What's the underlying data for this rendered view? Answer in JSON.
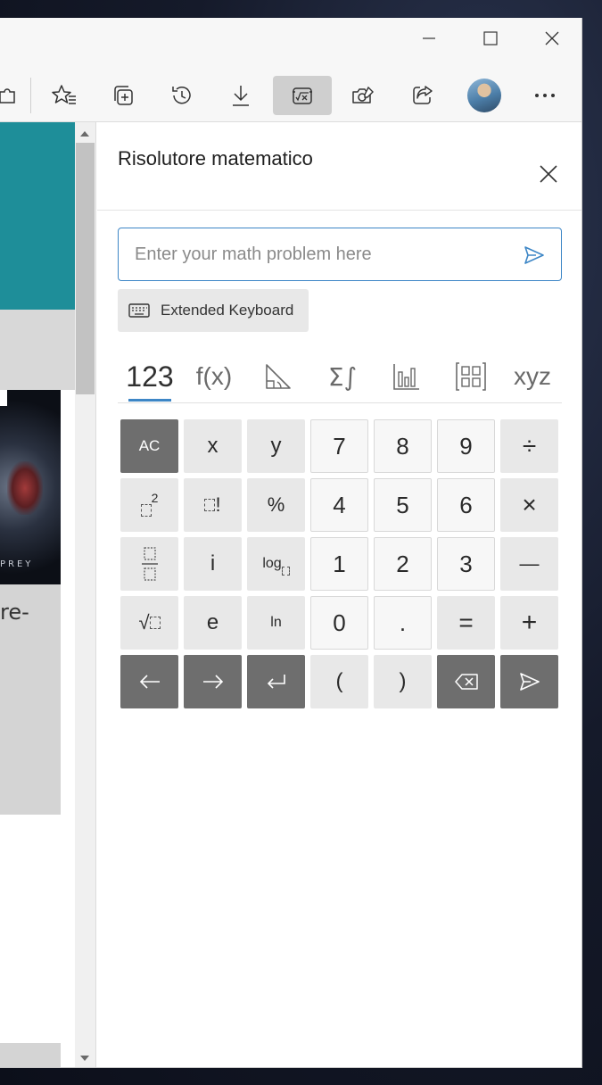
{
  "panel": {
    "title": "Risolutore matematico",
    "input_placeholder": "Enter your math problem here",
    "extended_keyboard_label": "Extended Keyboard"
  },
  "tabs": [
    {
      "label": "123",
      "active": true
    },
    {
      "label": "f(x)",
      "active": false
    },
    {
      "label": "triangle-icon",
      "active": false
    },
    {
      "label": "Σ∫",
      "active": false
    },
    {
      "label": "bar-chart-icon",
      "active": false
    },
    {
      "label": "matrix-icon",
      "active": false
    },
    {
      "label": "xyz",
      "active": false
    }
  ],
  "keys": {
    "ac": "AC",
    "x": "x",
    "y": "y",
    "n7": "7",
    "n8": "8",
    "n9": "9",
    "divide": "÷",
    "square_exp": "2",
    "factorial": "!",
    "percent": "%",
    "n4": "4",
    "n5": "5",
    "n6": "6",
    "multiply": "×",
    "i": "i",
    "log": "log",
    "n1": "1",
    "n2": "2",
    "n3": "3",
    "minus": "—",
    "sqrt": "√",
    "e": "e",
    "ln": "ln",
    "n0": "0",
    "dot": ".",
    "equals": "=",
    "plus": "+",
    "lparen": "(",
    "rparen": ")"
  },
  "page": {
    "game_text": "PREY",
    "text_snippet": "re-"
  },
  "colors": {
    "accent": "#3d86c6",
    "teal": "#1e8e99",
    "dark_key": "#6e6e6e"
  }
}
